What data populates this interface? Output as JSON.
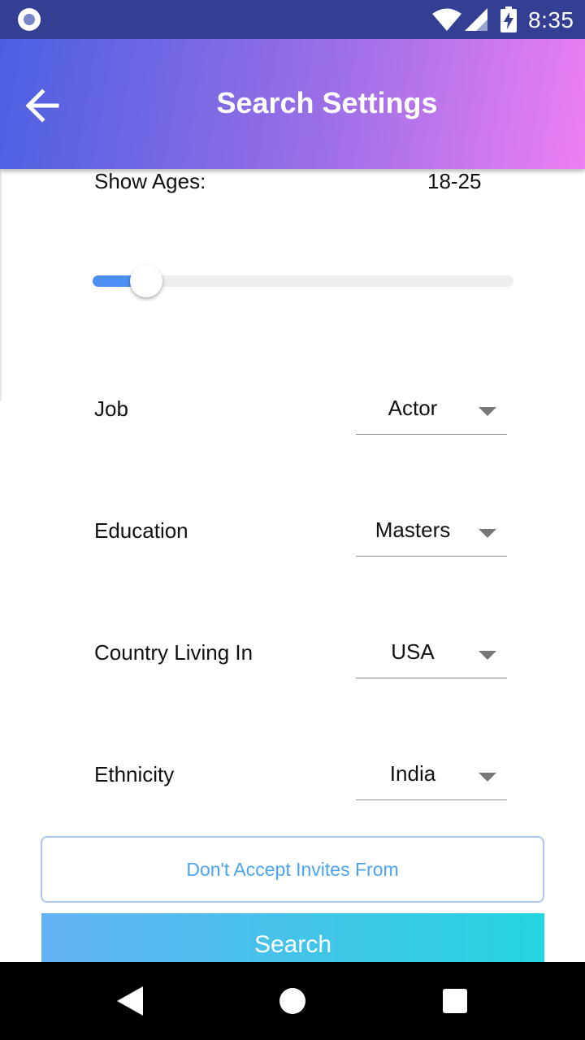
{
  "status_bar": {
    "time": "8:35",
    "icons": [
      "notification-dot-icon",
      "wifi-icon",
      "signal-icon",
      "battery-charging-icon"
    ]
  },
  "app_bar": {
    "title": "Search Settings",
    "back_icon": "arrow-left-icon"
  },
  "ages": {
    "label": "Show Ages:",
    "value": "18-25",
    "slider_fraction": 0.128
  },
  "fields": [
    {
      "label": "Job",
      "value": "Actor"
    },
    {
      "label": "Education",
      "value": "Masters"
    },
    {
      "label": "Country Living In",
      "value": "USA"
    },
    {
      "label": "Ethnicity",
      "value": "India"
    }
  ],
  "buttons": {
    "invites": "Don't Accept Invites From",
    "search": "Search"
  },
  "colors": {
    "status_bar": "#343f93",
    "header_gradient": [
      "#4a60e1",
      "#ee7ef3"
    ],
    "slider_fill": "#4d8ef2",
    "invites_text": "#4aa5ea",
    "search_gradient": [
      "#64b2f5",
      "#24d4de"
    ]
  },
  "nav_bar": {
    "icons": [
      "nav-back-icon",
      "nav-home-icon",
      "nav-recents-icon"
    ]
  }
}
